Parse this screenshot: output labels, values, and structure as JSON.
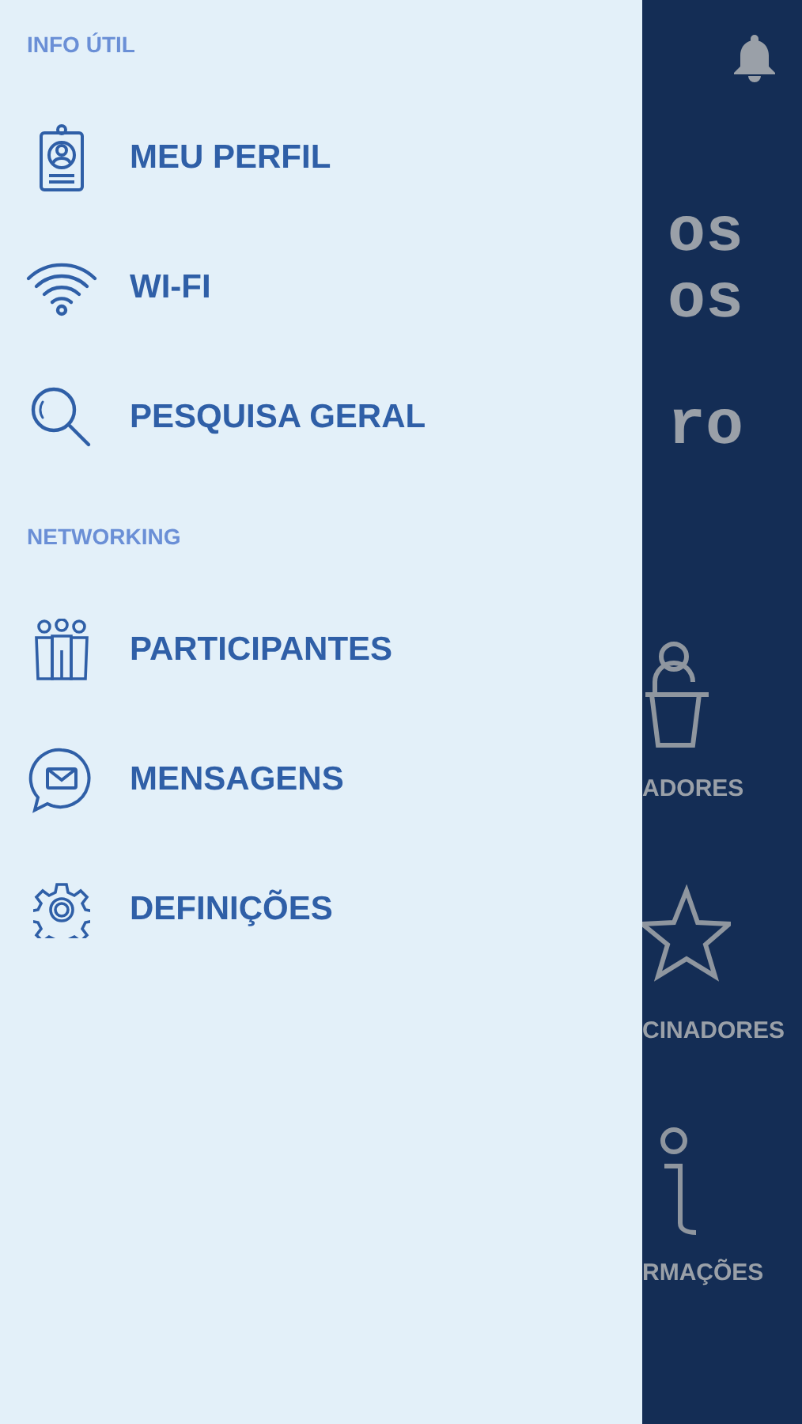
{
  "drawer": {
    "sections": [
      {
        "title": "INFO ÚTIL",
        "items": [
          {
            "kind": "badge",
            "label": "MEU PERFIL"
          },
          {
            "kind": "wifi",
            "label": "WI-FI"
          },
          {
            "kind": "search",
            "label": "PESQUISA GERAL"
          }
        ]
      },
      {
        "title": "NETWORKING",
        "items": [
          {
            "kind": "people",
            "label": "PARTICIPANTES"
          },
          {
            "kind": "message",
            "label": "MENSAGENS"
          },
          {
            "kind": "gear",
            "label": "DEFINIÇÕES"
          }
        ]
      }
    ]
  },
  "background": {
    "title_lines": [
      "os",
      "os",
      "ro"
    ],
    "tiles": [
      {
        "kind": "speaker",
        "label": "ADORES"
      },
      {
        "kind": "star",
        "label": "CINADORES"
      },
      {
        "kind": "info",
        "label": "RMAÇÕES"
      }
    ]
  }
}
